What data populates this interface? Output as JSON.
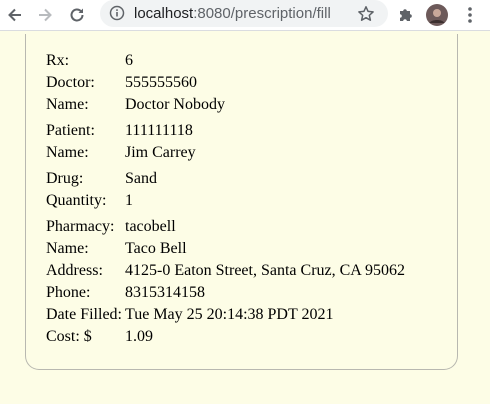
{
  "browser": {
    "url_host": "localhost",
    "url_port": ":8080",
    "url_path": "/prescription/fill"
  },
  "prescription": {
    "rx_label": "Rx:",
    "rx_value": "6",
    "doctor_label": "Doctor:",
    "doctor_value": "555555560",
    "doctor_name_label": "Name:",
    "doctor_name_value": "Doctor Nobody",
    "patient_label": "Patient:",
    "patient_value": "111111118",
    "patient_name_label": "Name:",
    "patient_name_value": "Jim Carrey",
    "drug_label": "Drug:",
    "drug_value": "Sand",
    "quantity_label": "Quantity:",
    "quantity_value": "1",
    "pharmacy_label": "Pharmacy:",
    "pharmacy_value": "tacobell",
    "pharmacy_name_label": "Name:",
    "pharmacy_name_value": "Taco Bell",
    "address_label": "Address:",
    "address_value": "4125-0 Eaton Street, Santa Cruz, CA 95062",
    "phone_label": "Phone:",
    "phone_value": "8315314158",
    "date_filled_label": "Date Filled:",
    "date_filled_value": "Tue May 25 20:14:38 PDT 2021",
    "cost_label": "Cost: $",
    "cost_value": "1.09"
  }
}
